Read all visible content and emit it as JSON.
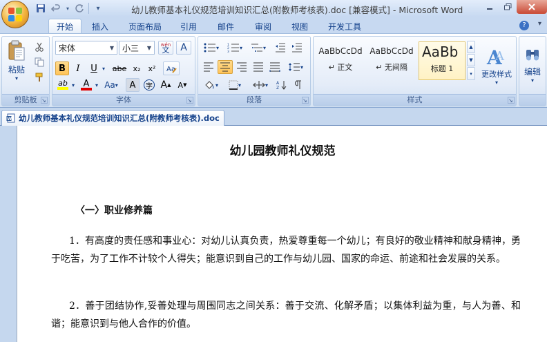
{
  "window": {
    "title": "幼儿教师基本礼仪规范培训知识汇总(附教师考核表).doc [兼容模式] - Microsoft Word"
  },
  "qat": {
    "save_icon": "save-icon",
    "undo_icon": "undo-icon",
    "redo_icon": "redo-icon",
    "customize_icon": "chevron-down-icon"
  },
  "tabs": [
    "开始",
    "插入",
    "页面布局",
    "引用",
    "邮件",
    "审阅",
    "视图",
    "开发工具"
  ],
  "ribbon": {
    "clipboard": {
      "label": "剪贴板",
      "paste_label": "粘贴"
    },
    "font": {
      "label": "字体",
      "font_name": "宋体",
      "font_size": "小三",
      "wen_label": "wén",
      "wen_char": "文",
      "a_char": "A",
      "aa_char": "Aa",
      "bold": "B",
      "italic": "I",
      "underline": "U",
      "strike": "abe",
      "subscript": "x₂",
      "superscript": "x²",
      "highlight": "ab",
      "fontcolor": "A",
      "charshade": "A",
      "enclose": "字",
      "grow": "A",
      "shrink": "A"
    },
    "paragraph": {
      "label": "段落"
    },
    "styles": {
      "label": "样式",
      "items": [
        {
          "preview": "AaBbCcDd",
          "name": "↵ 正文"
        },
        {
          "preview": "AaBbCcDd",
          "name": "↵ 无间隔"
        },
        {
          "preview": "AaBb",
          "name": "标题 1"
        }
      ],
      "change_label": "更改样式"
    },
    "editing": {
      "label": "编辑"
    }
  },
  "doc_tab": {
    "label": "幼儿教师基本礼仪规范培训知识汇总(附教师考核表).doc"
  },
  "document": {
    "title": "幼儿园教师礼仪规范",
    "section": "〈一〉职业修养篇",
    "paragraphs": [
      "1．有高度的责任感和事业心：对幼儿认真负责，热爱尊重每一个幼儿；有良好的敬业精神和献身精神，勇于吃苦，为了工作不计较个人得失；能意识到自己的工作与幼儿园、国家的命运、前途和社会发展的关系。",
      "2．善于团结协作,妥善处理与周围同志之间关系：善于交流、化解矛盾；以集体利益为重，与人为善、和谐；能意识到与他人合作的价值。"
    ]
  },
  "colors": {
    "ribbon_text": "#15428b",
    "title_bar": "#c7d9f1",
    "active_highlight": "#ffc45a"
  }
}
